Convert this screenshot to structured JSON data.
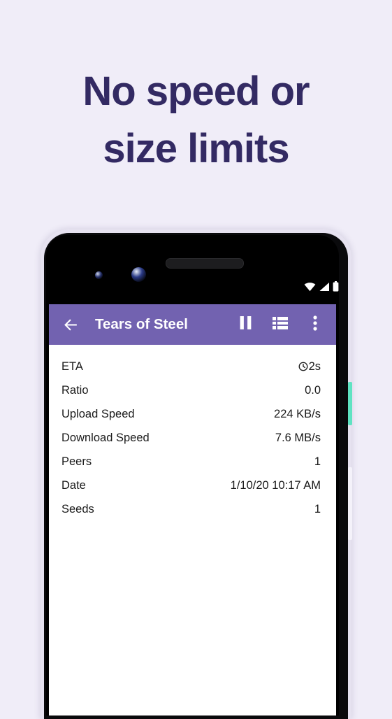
{
  "promo": {
    "headline_lines": [
      "No speed or",
      "size limits"
    ],
    "background_color": "#f0edf8",
    "headline_color": "#332a63"
  },
  "device": {
    "frame_color": "#0a0a0c",
    "rim_color": "#e6e2f0",
    "power_button_color": "#5fe3c2",
    "volume_button_color": "#f4f2fa",
    "status_bar": {
      "icons": [
        "wifi-icon",
        "cellular-signal-icon",
        "battery-icon"
      ]
    }
  },
  "app": {
    "accent_color": "#7262b0",
    "appbar": {
      "back_icon": "back-arrow-icon",
      "title": "Tears of Steel",
      "actions": [
        {
          "icon": "pause-icon",
          "name": "pause-button"
        },
        {
          "icon": "list-icon",
          "name": "file-list-button"
        },
        {
          "icon": "overflow-menu-icon",
          "name": "overflow-menu-button"
        }
      ]
    },
    "details": [
      {
        "label": "ETA",
        "value": "2s",
        "icon": "clock-icon"
      },
      {
        "label": "Ratio",
        "value": "0.0",
        "icon": ""
      },
      {
        "label": "Upload Speed",
        "value": "224 KB/s",
        "icon": ""
      },
      {
        "label": "Download Speed",
        "value": "7.6 MB/s",
        "icon": ""
      },
      {
        "label": "Peers",
        "value": "1",
        "icon": ""
      },
      {
        "label": "Date",
        "value": "1/10/20 10:17 AM",
        "icon": ""
      },
      {
        "label": "Seeds",
        "value": "1",
        "icon": ""
      }
    ]
  }
}
